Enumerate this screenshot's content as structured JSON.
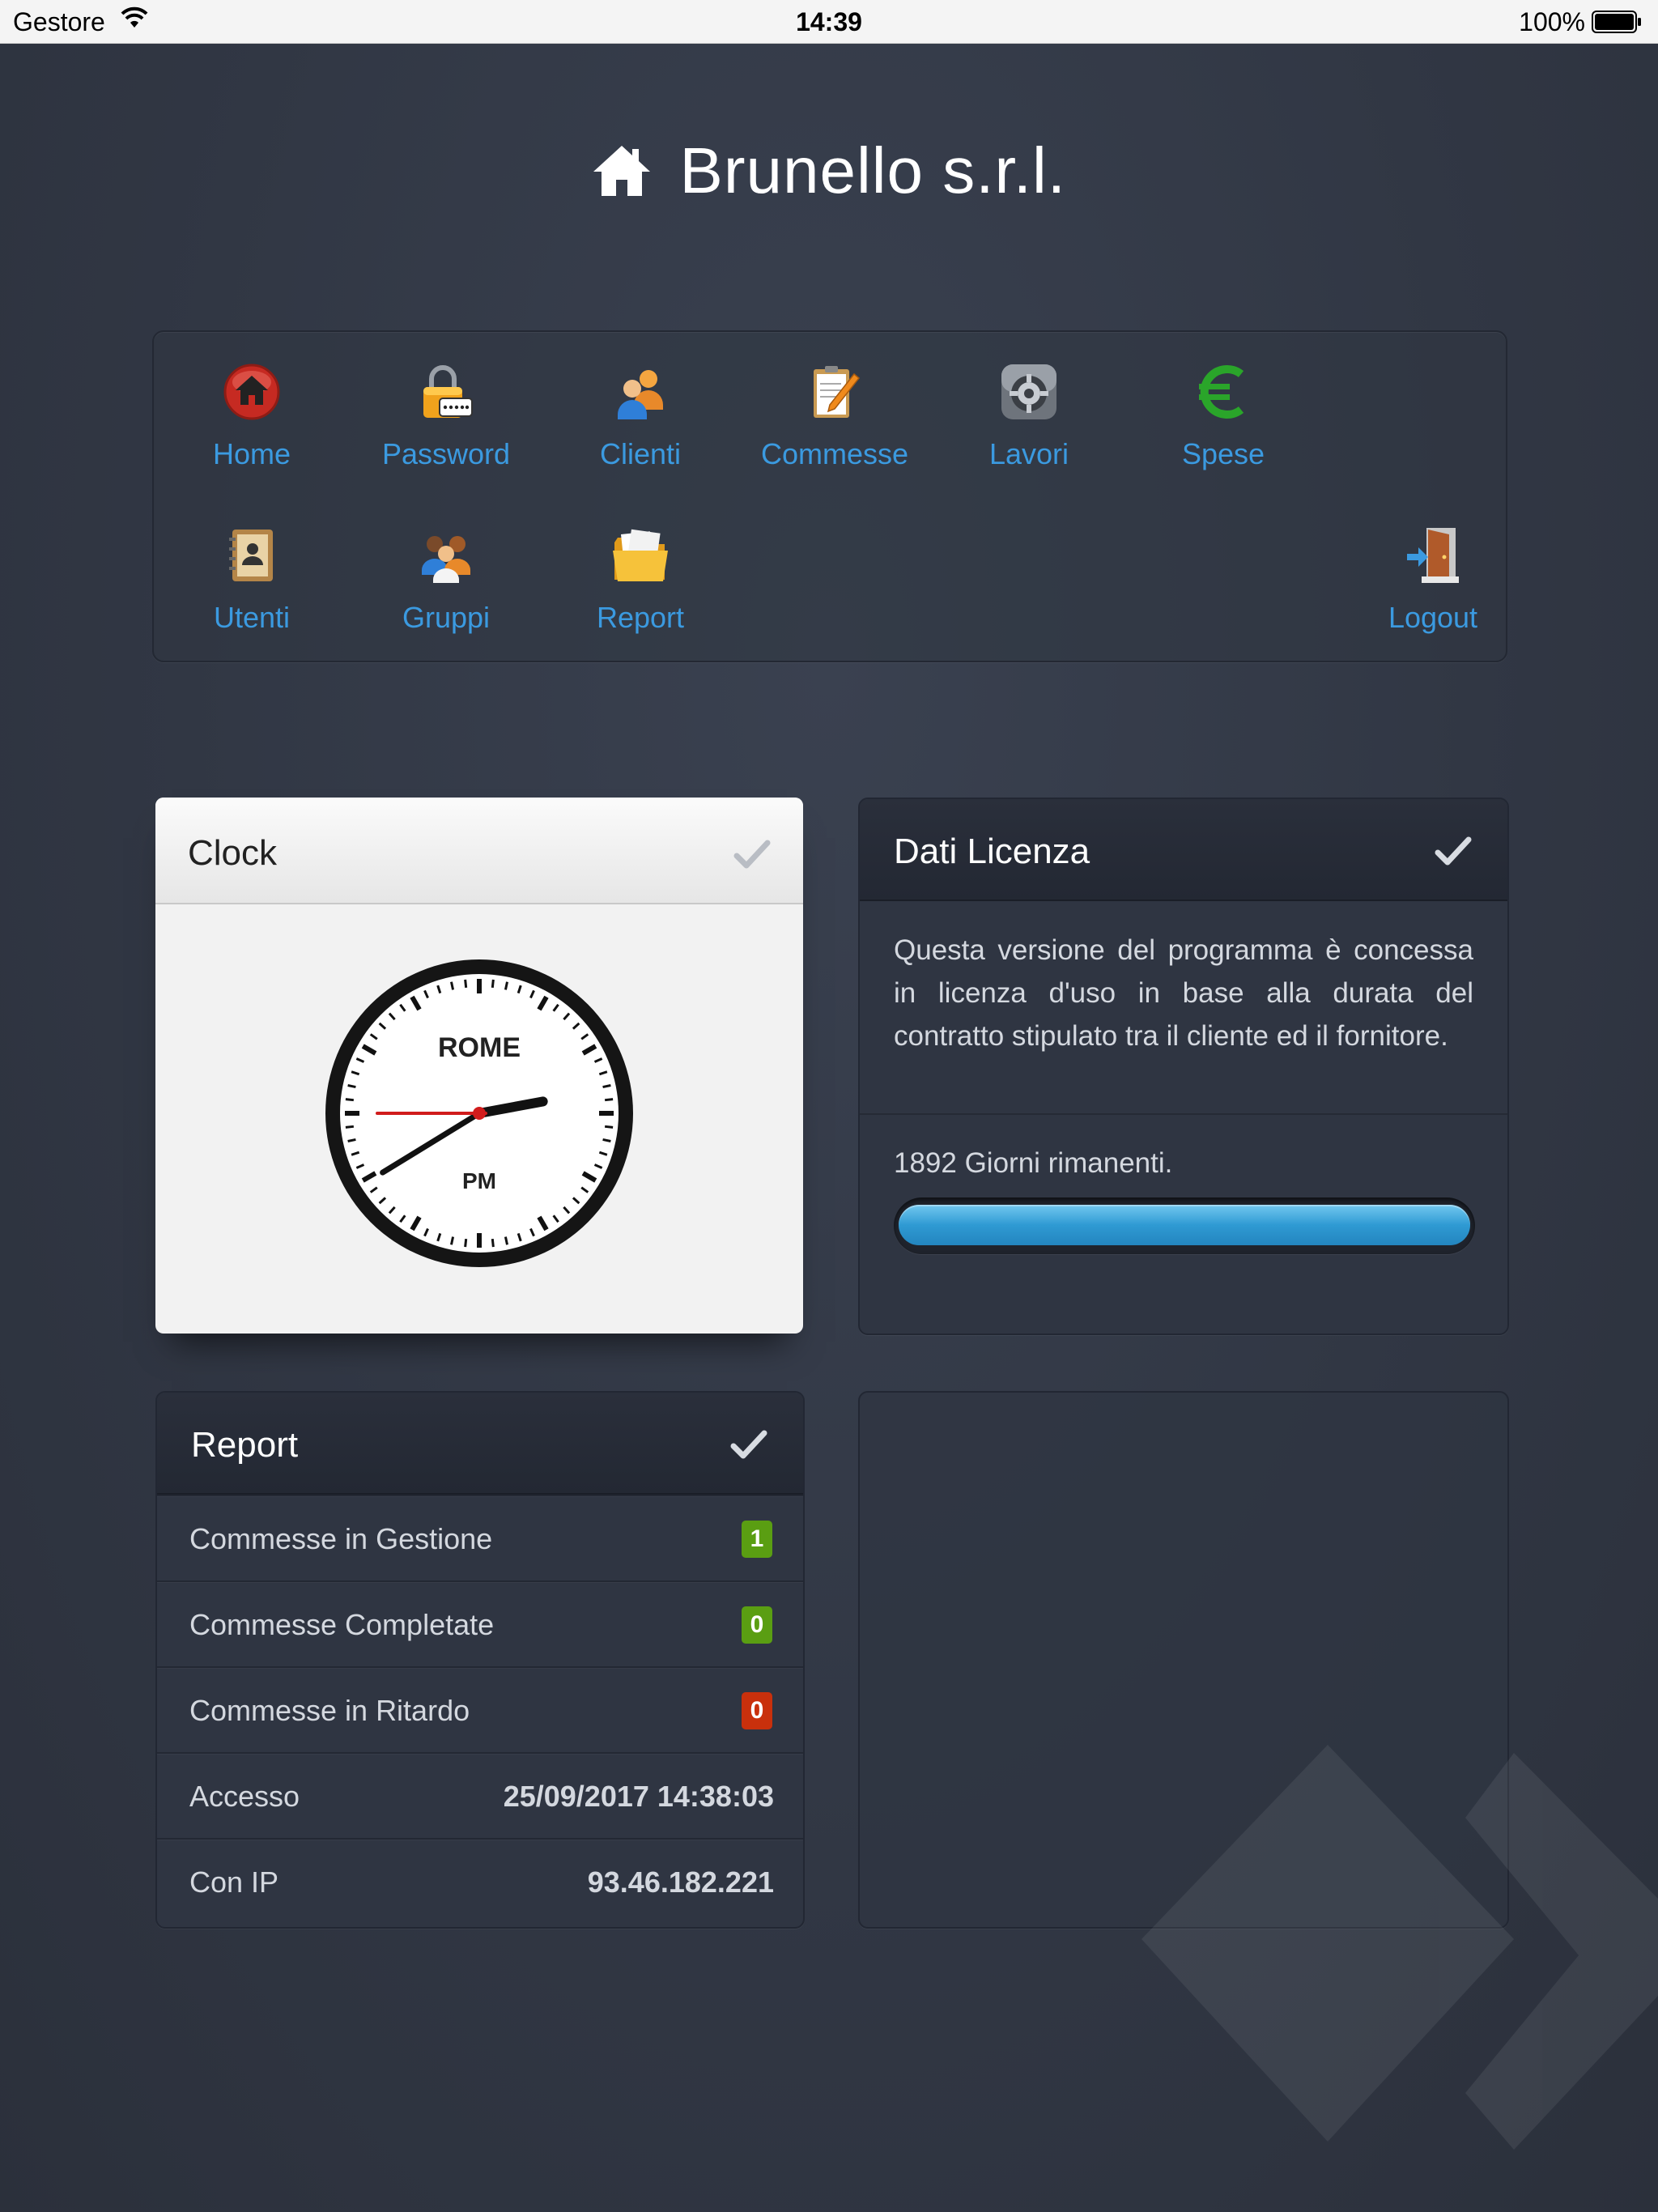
{
  "status_bar": {
    "carrier": "Gestore",
    "time": "14:39",
    "battery": "100%"
  },
  "header": {
    "title": "Brunello s.r.l.",
    "icon": "home-icon"
  },
  "nav": {
    "items": [
      {
        "label": "Home",
        "icon": "home-icon"
      },
      {
        "label": "Password",
        "icon": "lock-icon"
      },
      {
        "label": "Clienti",
        "icon": "users-icon"
      },
      {
        "label": "Commesse",
        "icon": "notepad-icon"
      },
      {
        "label": "Lavori",
        "icon": "gear-icon"
      },
      {
        "label": "Spese",
        "icon": "euro-icon"
      },
      {
        "label": "Utenti",
        "icon": "address-book-icon"
      },
      {
        "label": "Gruppi",
        "icon": "group-icon"
      },
      {
        "label": "Report",
        "icon": "folder-icon"
      },
      {
        "label": "Logout",
        "icon": "logout-door-icon"
      }
    ]
  },
  "clock": {
    "title": "Clock",
    "city": "ROME",
    "period": "PM",
    "hour": 14,
    "minute": 39,
    "second": 45
  },
  "license": {
    "title": "Dati Licenza",
    "description": "Questa versione del programma è concessa in licenza d'uso in base alla durata del contratto stipulato tra il cliente ed il fornitore.",
    "days_remaining": "1892 Giorni rimanenti.",
    "progress_fraction": 1.0
  },
  "report": {
    "title": "Report",
    "rows": [
      {
        "label": "Commesse in Gestione",
        "value": "1"
      },
      {
        "label": "Commesse Completate",
        "value": "0"
      },
      {
        "label": "Commesse in Ritardo",
        "value": "0"
      },
      {
        "label": "Accesso",
        "value": "25/09/2017 14:38:03"
      },
      {
        "label": "Con IP",
        "value": "93.46.182.221"
      }
    ]
  },
  "colors": {
    "link": "#3b9ae0",
    "badge_green": "#5a9e12",
    "badge_red": "#c9300c",
    "progress": "#2f9ad3"
  }
}
